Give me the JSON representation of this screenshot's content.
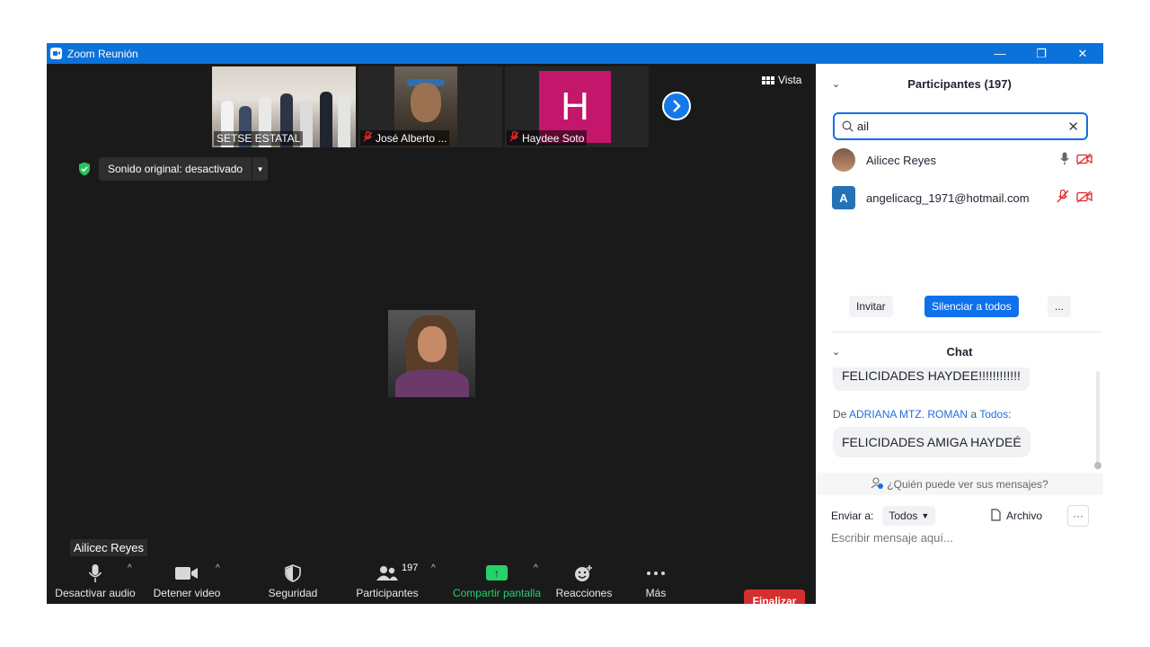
{
  "window": {
    "title": "Zoom Reunión",
    "controls": [
      "—",
      "❐",
      "✕"
    ]
  },
  "thumbnails": [
    {
      "label": "SETSE ESTATAL",
      "muted": false
    },
    {
      "label": "José Alberto ...",
      "muted": true
    },
    {
      "label": "Haydee Soto",
      "muted": true,
      "initial": "H",
      "color": "#c4176b"
    }
  ],
  "view": {
    "label": "Vista"
  },
  "sound": {
    "label": "Sonido original: desactivado"
  },
  "speaker": {
    "name": "Ailicec Reyes"
  },
  "toolbar": {
    "audio": "Desactivar audio",
    "video": "Detener video",
    "security": "Seguridad",
    "participants": "Participantes",
    "participants_count": "197",
    "share": "Compartir pantalla",
    "reactions": "Reacciones",
    "more": "Más",
    "end": "Finalizar"
  },
  "participants_panel": {
    "title": "Participantes (197)",
    "search_value": "ail",
    "list": [
      {
        "name": "Ailicec Reyes",
        "avatar_type": "photo"
      },
      {
        "name": "angelicacg_1971@hotmail.com",
        "avatar_initial": "A",
        "avatar_color": "#2472b8"
      }
    ],
    "actions": {
      "invite": "Invitar",
      "mute_all": "Silenciar a todos",
      "more": "..."
    }
  },
  "chat": {
    "title": "Chat",
    "messages": [
      {
        "text": "FELICIDADES HAYDEE!!!!!!!!!!!!"
      },
      {
        "from_prefix": "De",
        "from": "ADRIANA MTZ. ROMAN",
        "to_prefix": "a",
        "to": "Todos",
        "text": "FELICIDADES AMIGA HAYDEÉ"
      }
    ],
    "who_can_see": "¿Quién puede ver sus mensajes?",
    "send_to_label": "Enviar a:",
    "send_to_value": "Todos",
    "file_label": "Archivo",
    "input_placeholder": "Escribir mensaje aquí..."
  }
}
